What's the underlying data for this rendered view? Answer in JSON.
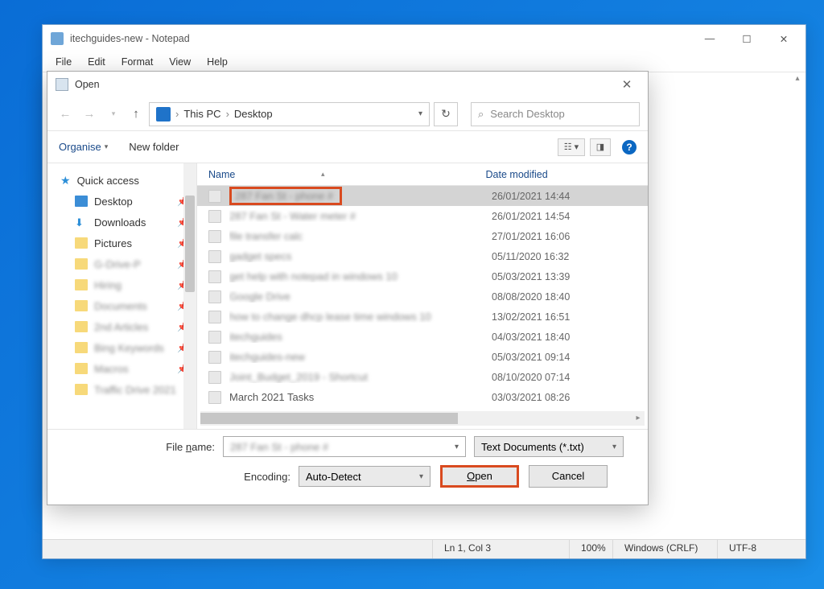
{
  "notepad": {
    "title": "itechguides-new - Notepad",
    "menus": [
      "File",
      "Edit",
      "Format",
      "View",
      "Help"
    ],
    "status": {
      "pos": "Ln 1, Col 3",
      "zoom": "100%",
      "eol": "Windows (CRLF)",
      "enc": "UTF-8"
    }
  },
  "dialog": {
    "title": "Open",
    "path": {
      "root": "This PC",
      "folder": "Desktop"
    },
    "search_placeholder": "Search Desktop",
    "organise": "Organise",
    "new_folder": "New folder",
    "headers": {
      "name": "Name",
      "date": "Date modified"
    },
    "sidebar": {
      "quick": "Quick access",
      "items": [
        {
          "label": "Desktop"
        },
        {
          "label": "Downloads"
        },
        {
          "label": "Pictures"
        },
        {
          "label": "G-Drive-P"
        },
        {
          "label": "Hiring"
        },
        {
          "label": "Documents"
        },
        {
          "label": "2nd Articles"
        },
        {
          "label": "Bing Keywords"
        },
        {
          "label": "Macros"
        },
        {
          "label": "Traffic Drive 2021"
        }
      ]
    },
    "files": [
      {
        "name": "287 Fan St - phone #",
        "date": "26/01/2021 14:44",
        "blur": true,
        "selected": true,
        "highlight": true
      },
      {
        "name": "287 Fan St - Water meter #",
        "date": "26/01/2021 14:54",
        "blur": true
      },
      {
        "name": "file transfer calc",
        "date": "27/01/2021 16:06",
        "blur": true
      },
      {
        "name": "gadget specs",
        "date": "05/11/2020 16:32",
        "blur": true
      },
      {
        "name": "get help with notepad in windows 10",
        "date": "05/03/2021 13:39",
        "blur": true
      },
      {
        "name": "Google Drive",
        "date": "08/08/2020 18:40",
        "blur": true
      },
      {
        "name": "how to change dhcp lease time windows 10",
        "date": "13/02/2021 16:51",
        "blur": true
      },
      {
        "name": "itechguides",
        "date": "04/03/2021 18:40",
        "blur": true
      },
      {
        "name": "itechguides-new",
        "date": "05/03/2021 09:14",
        "blur": true
      },
      {
        "name": "Joint_Budget_2019 - Shortcut",
        "date": "08/10/2020 07:14",
        "blur": true
      },
      {
        "name": "March 2021 Tasks",
        "date": "03/03/2021 08:26",
        "blur": false
      }
    ],
    "filename_label": "File name:",
    "filename_value": "287 Fan St - phone #",
    "filter": "Text Documents (*.txt)",
    "encoding_label": "Encoding:",
    "encoding_value": "Auto-Detect",
    "open_btn": "Open",
    "cancel_btn": "Cancel"
  }
}
